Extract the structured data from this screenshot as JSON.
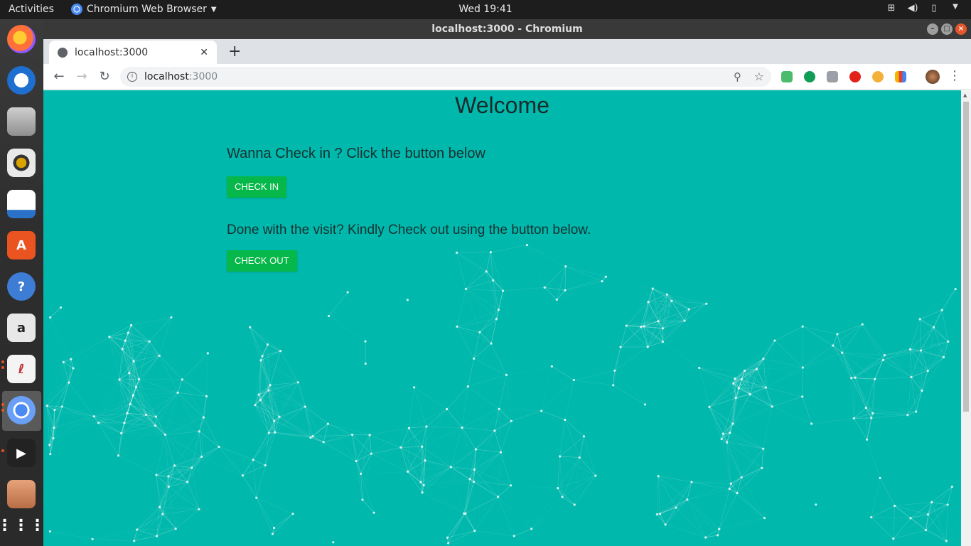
{
  "topbar": {
    "activities": "Activities",
    "app_menu": "Chromium Web Browser",
    "clock": "Wed 19:41",
    "tray_icons": [
      "network-icon",
      "volume-icon",
      "battery-icon",
      "system-menu-icon"
    ]
  },
  "dock": {
    "apps": [
      "firefox",
      "thunderbird",
      "files-cabinet",
      "rhythmbox",
      "libreoffice-writer",
      "ubuntu-software",
      "help",
      "amazon",
      "document-viewer",
      "chromium",
      "media-player",
      "files",
      "show-applications"
    ]
  },
  "window": {
    "title": "localhost:3000 - Chromium"
  },
  "tab": {
    "title": "localhost:3000"
  },
  "omnibox": {
    "host": "localhost",
    "port": ":3000"
  },
  "page": {
    "heading": "Welcome",
    "checkin_prompt": "Wanna Check in ? Click the button below",
    "checkin_button": "CHECK IN",
    "checkout_prompt": "Done with the visit? Kindly Check out using the button below.",
    "checkout_button": "CHECK OUT",
    "background_color": "#00b8ac",
    "button_color": "#06b84a"
  }
}
